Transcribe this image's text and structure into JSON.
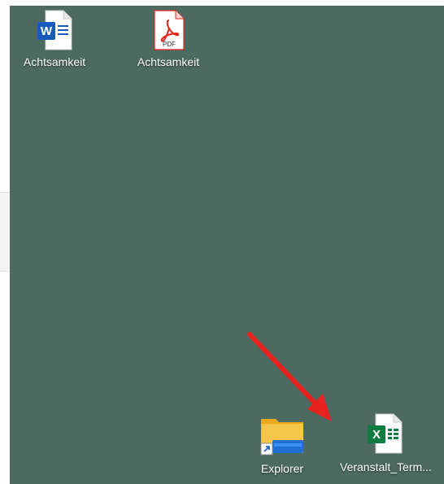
{
  "desktop": {
    "background_color": "#4c6a60",
    "icons": [
      {
        "label": "Achtsamkeit",
        "icon": "word-document-icon"
      },
      {
        "label": "Achtsamkeit",
        "icon": "pdf-document-icon",
        "badge": "PDF"
      },
      {
        "label": "Explorer",
        "icon": "file-explorer-shortcut-icon"
      },
      {
        "label": "Veranstalt_Term...",
        "icon": "excel-spreadsheet-icon"
      }
    ]
  },
  "annotation": {
    "type": "red-arrow",
    "color": "#e8231f",
    "target": "excel-spreadsheet-icon"
  },
  "colors": {
    "word": "#185abd",
    "pdf": "#e2261b",
    "excel": "#107c41",
    "folder": "#f5c033"
  }
}
